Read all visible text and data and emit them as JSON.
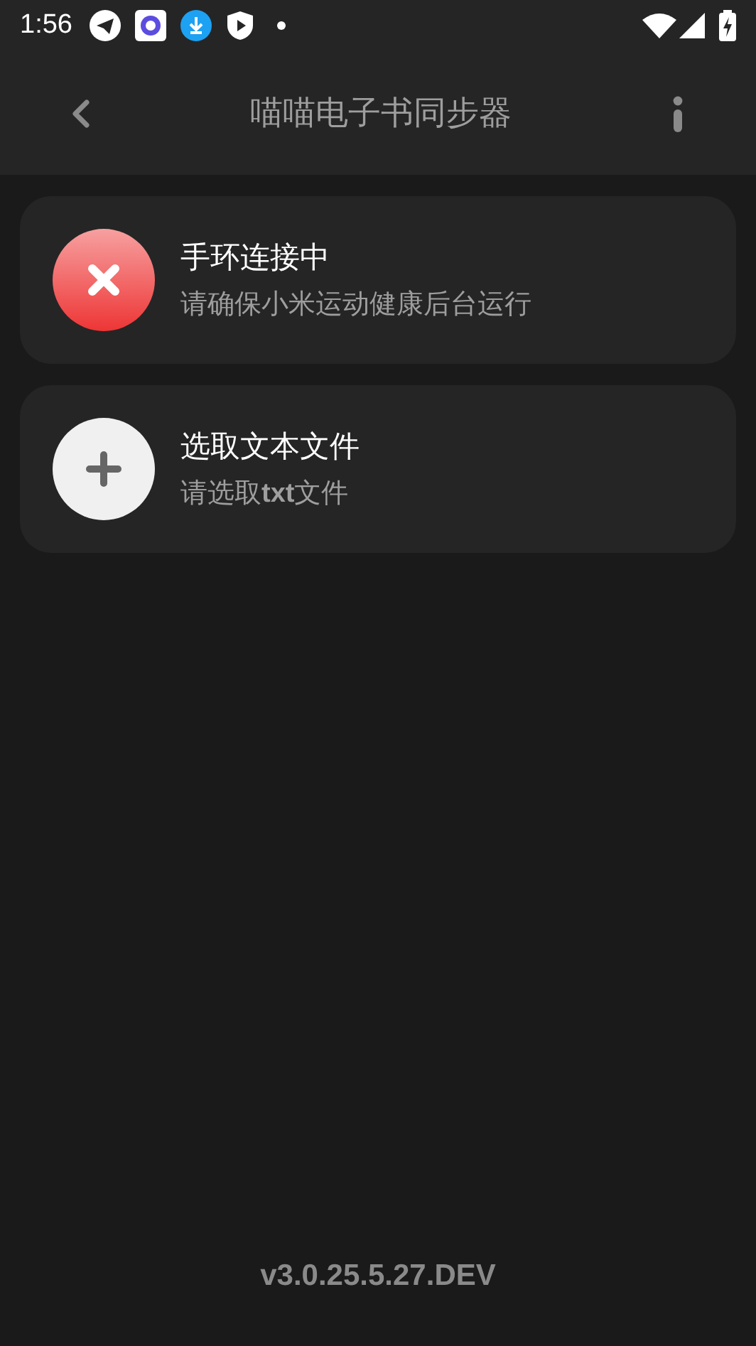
{
  "status_bar": {
    "time": "1:56"
  },
  "app_bar": {
    "title": "喵喵电子书同步器"
  },
  "cards": [
    {
      "kind": "error",
      "title": "手环连接中",
      "subtitle": "请确保小米运动健康后台运行"
    },
    {
      "kind": "add",
      "title": "选取文本文件",
      "subtitle": "请选取**txt**文件"
    }
  ],
  "version": "v3.0.25.5.27.DEV"
}
